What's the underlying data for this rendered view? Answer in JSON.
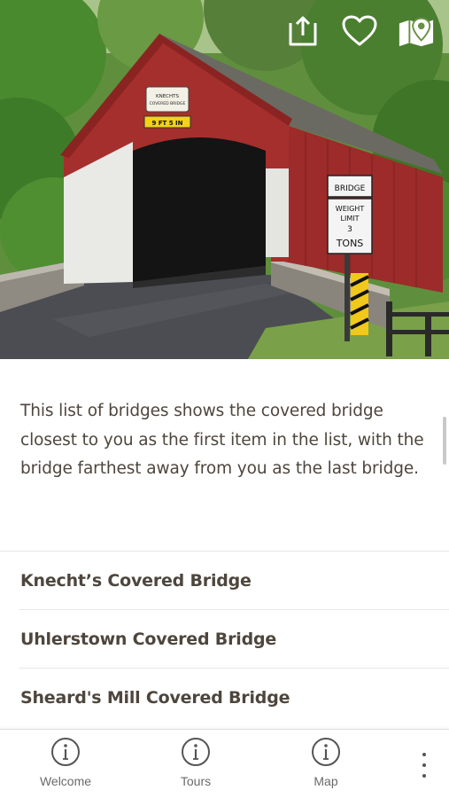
{
  "hero": {
    "sign_name_1": "KNECHTS",
    "sign_name_2": "COVERED BRIDGE",
    "sign_clearance": "9 FT 5 IN",
    "sign_bridge": "BRIDGE",
    "sign_weight": "WEIGHT",
    "sign_limit": "LIMIT",
    "sign_num": "3",
    "sign_tons": "TONS",
    "actions": [
      {
        "icon": "share-icon"
      },
      {
        "icon": "heart-icon"
      },
      {
        "icon": "map-pin-icon"
      }
    ]
  },
  "intro": {
    "text": "This list of bridges shows the covered bridge closest to you as the first item in the list, with the bridge farthest away from you as the last bridge."
  },
  "bridges": [
    {
      "label": "Knecht’s Covered Bridge"
    },
    {
      "label": "Uhlerstown Covered Bridge"
    },
    {
      "label": "Sheard's Mill Covered Bridge"
    }
  ],
  "bottom_nav": {
    "items": [
      {
        "label": "Welcome",
        "icon": "info-icon"
      },
      {
        "label": "Tours",
        "icon": "info-icon"
      },
      {
        "label": "Map",
        "icon": "info-icon"
      }
    ],
    "more_icon": "more-vertical-icon"
  },
  "colors": {
    "text": "#4e463d",
    "bridge_red": "#9c2b2a",
    "foliage": "#3f7a2a"
  }
}
